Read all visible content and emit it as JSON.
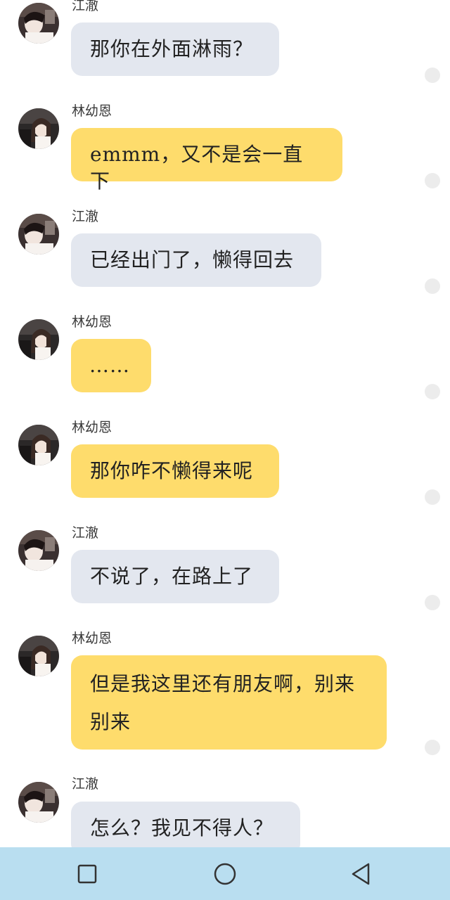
{
  "chat": {
    "messages": [
      {
        "sender": "江澈",
        "text": "那你在外面淋雨？",
        "side": "gray"
      },
      {
        "sender": "林幼恩",
        "text": "emmm，又不是会一直下",
        "side": "yellow"
      },
      {
        "sender": "江澈",
        "text": "已经出门了，懒得回去",
        "side": "gray"
      },
      {
        "sender": "林幼恩",
        "text": "……",
        "side": "yellow"
      },
      {
        "sender": "林幼恩",
        "text": "那你咋不懒得来呢",
        "side": "yellow"
      },
      {
        "sender": "江澈",
        "text": "不说了，在路上了",
        "side": "gray"
      },
      {
        "sender": "林幼恩",
        "text": "但是我这里还有朋友啊，别来别来",
        "side": "yellow"
      },
      {
        "sender": "江澈",
        "text": "怎么？我见不得人？",
        "side": "gray"
      }
    ]
  },
  "colors": {
    "gray_bubble": "#e3e7ef",
    "yellow_bubble": "#fedc6c",
    "navbar": "#b9def0",
    "nav_icon": "#333333"
  },
  "navbar": {
    "icons": [
      "recent-apps-square-icon",
      "home-circle-icon",
      "back-triangle-icon"
    ]
  }
}
